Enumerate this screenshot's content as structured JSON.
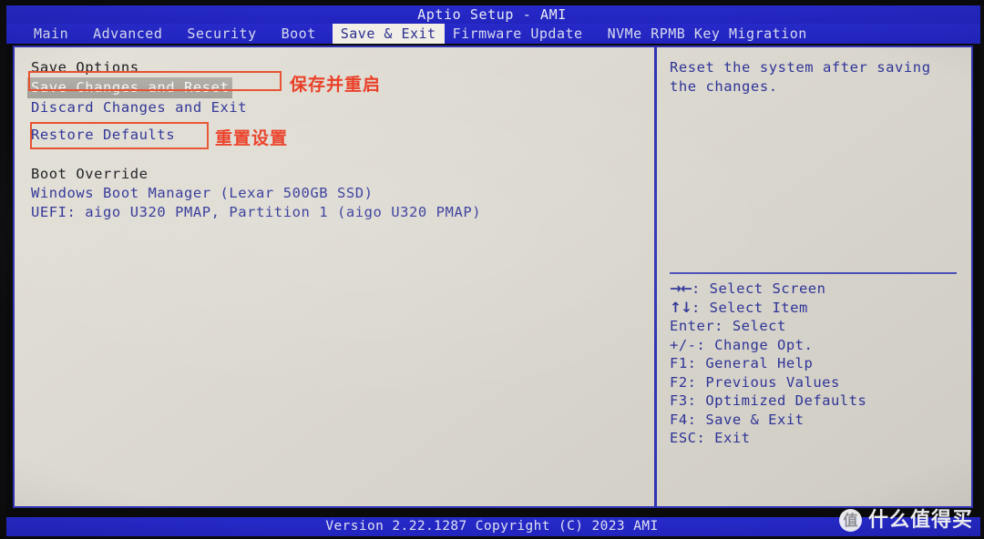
{
  "window": {
    "title": "Aptio Setup - AMI",
    "footer": "Version 2.22.1287 Copyright (C) 2023 AMI"
  },
  "colors": {
    "chrome_blue": "#2326c4",
    "text_blue": "#2f3497",
    "active_tab_bg": "#f0eee6",
    "panel_bg": "#dedbd3",
    "selected_row_bg": "#a9a6a0",
    "annotation_red": "#ea3b22"
  },
  "tabs": [
    {
      "label": "Main",
      "active": false
    },
    {
      "label": "Advanced",
      "active": false
    },
    {
      "label": "Security",
      "active": false
    },
    {
      "label": "Boot",
      "active": false
    },
    {
      "label": "Save & Exit",
      "active": true
    },
    {
      "label": "Firmware Update",
      "active": false
    },
    {
      "label": "NVMe RPMB Key Migration",
      "active": false
    }
  ],
  "left_pane": {
    "save_options_heading": "Save Options",
    "items": [
      {
        "label": "Save Changes and Reset",
        "selected": true
      },
      {
        "label": "Discard Changes and Exit",
        "selected": false
      },
      {
        "label": "Restore Defaults",
        "selected": false
      }
    ],
    "boot_override_heading": "Boot Override",
    "boot_entries": [
      "Windows Boot Manager (Lexar 500GB SSD)",
      "UEFI: aigo U320 PMAP, Partition 1 (aigo U320 PMAP)"
    ]
  },
  "annotations": [
    {
      "target": "Save Changes and Reset",
      "text": "保存并重启"
    },
    {
      "target": "Restore Defaults",
      "text": "重置设置"
    }
  ],
  "right_pane": {
    "help_lines": [
      "Reset the system after saving",
      "the changes."
    ],
    "key_legend": [
      {
        "glyph": "→←",
        "keys": "",
        "desc": ": Select Screen"
      },
      {
        "glyph": "↑↓",
        "keys": "",
        "desc": ": Select Item"
      },
      {
        "glyph": "",
        "keys": "Enter",
        "desc": ": Select"
      },
      {
        "glyph": "",
        "keys": "+/-",
        "desc": ": Change Opt."
      },
      {
        "glyph": "",
        "keys": "F1",
        "desc": ": General Help"
      },
      {
        "glyph": "",
        "keys": "F2",
        "desc": ": Previous Values"
      },
      {
        "glyph": "",
        "keys": "F3",
        "desc": ": Optimized Defaults"
      },
      {
        "glyph": "",
        "keys": "F4",
        "desc": ": Save & Exit"
      },
      {
        "glyph": "",
        "keys": "ESC",
        "desc": ": Exit"
      }
    ]
  },
  "watermark": {
    "badge": "值",
    "text": "什么值得买"
  }
}
